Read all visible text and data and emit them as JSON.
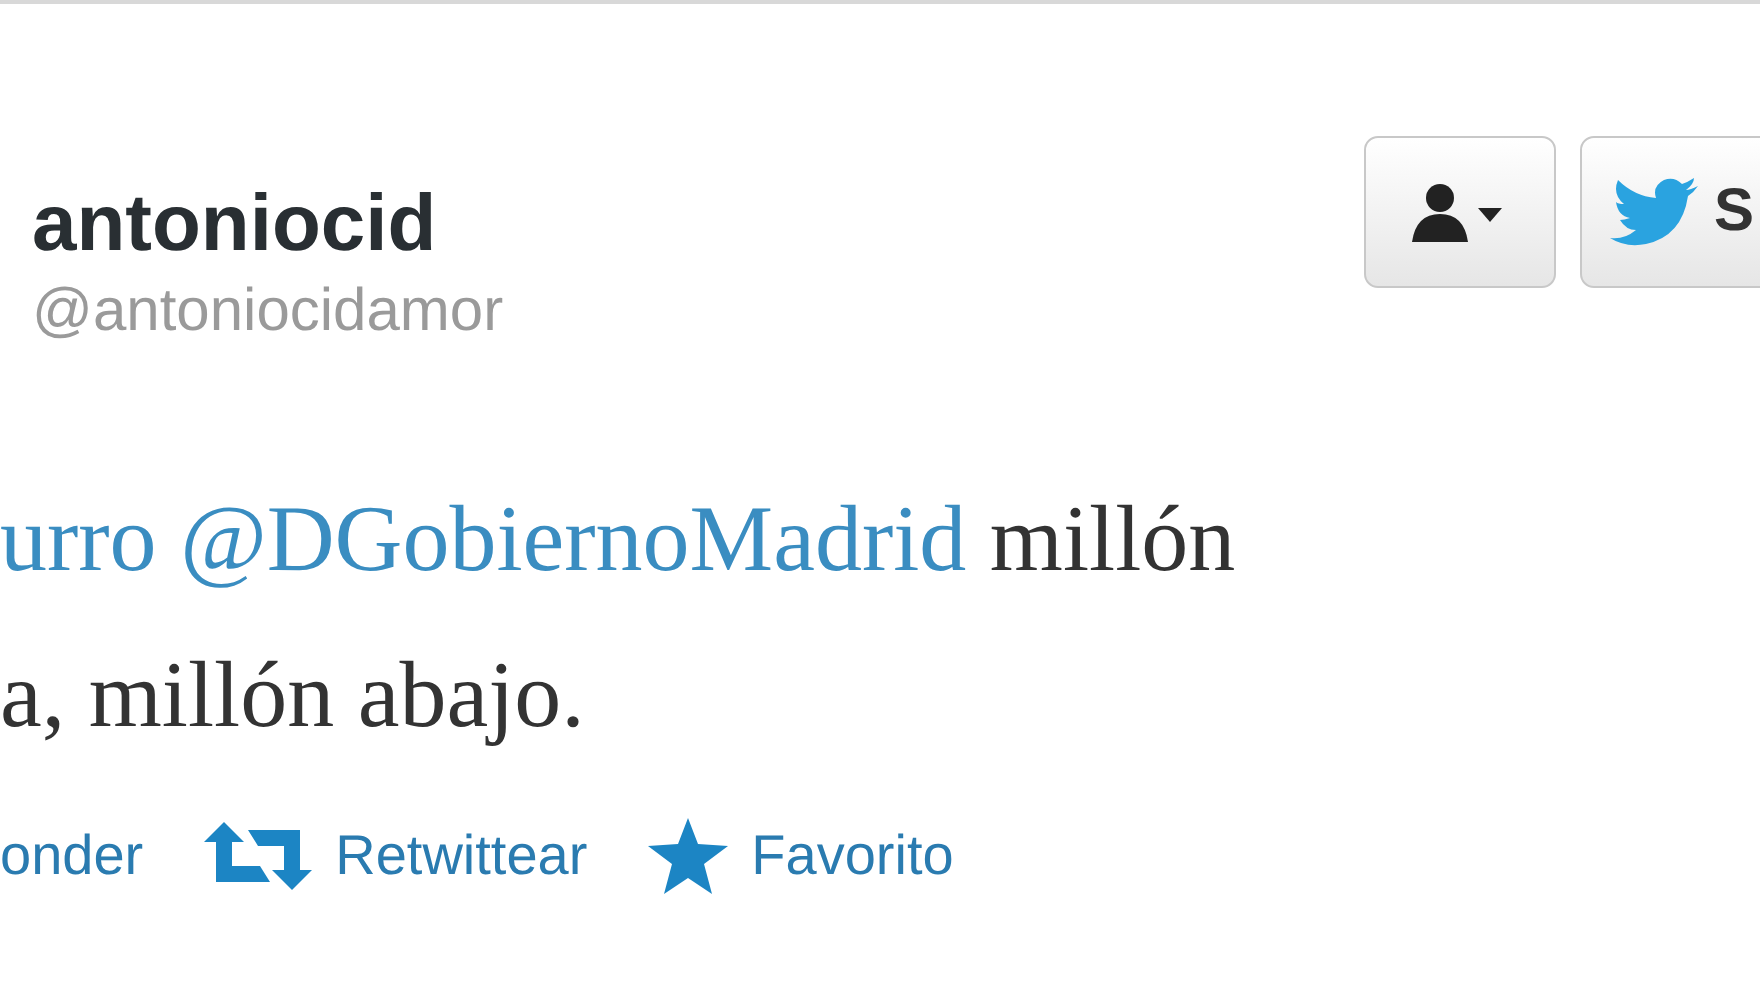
{
  "user": {
    "name": "antoniocid",
    "handle": "@antoniocidamor"
  },
  "buttons": [
    {
      "kind": "user-menu"
    },
    {
      "kind": "follow",
      "label": "S"
    }
  ],
  "tweet": {
    "lines": [
      [
        {
          "text": "urro ",
          "link": true
        },
        {
          "text": "@DGobiernoMadrid",
          "link": true
        },
        {
          "text": " millón",
          "link": false
        }
      ],
      [
        {
          "text": "a, millón abajo.",
          "link": false
        }
      ]
    ]
  },
  "actions": [
    {
      "kind": "reply",
      "label": "onder"
    },
    {
      "kind": "retweet",
      "label": "Retwittear"
    },
    {
      "kind": "favorite",
      "label": "Favorito"
    }
  ]
}
